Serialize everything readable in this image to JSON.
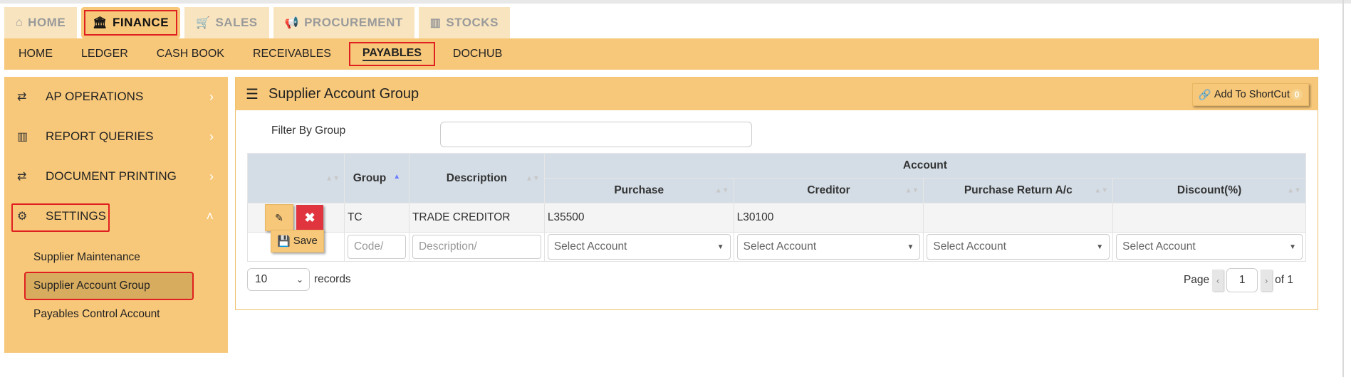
{
  "main_tabs": [
    {
      "label": "HOME",
      "icon": "home-icon",
      "active": false
    },
    {
      "label": "FINANCE",
      "icon": "bank-icon",
      "active": true
    },
    {
      "label": "SALES",
      "icon": "cart-icon",
      "active": false
    },
    {
      "label": "PROCUREMENT",
      "icon": "bullhorn-icon",
      "active": false
    },
    {
      "label": "STOCKS",
      "icon": "bar-chart-icon",
      "active": false
    }
  ],
  "sub_nav": {
    "items": [
      "HOME",
      "LEDGER",
      "CASH BOOK",
      "RECEIVABLES",
      "PAYABLES",
      "DOCHUB"
    ],
    "active": "PAYABLES"
  },
  "sidebar": {
    "items": [
      {
        "label": "AP OPERATIONS",
        "icon": "exchange-icon"
      },
      {
        "label": "REPORT QUERIES",
        "icon": "bar-chart-icon"
      },
      {
        "label": "DOCUMENT PRINTING",
        "icon": "exchange-icon"
      },
      {
        "label": "SETTINGS",
        "icon": "cogs-icon"
      }
    ],
    "sub_items": [
      "Supplier Maintenance",
      "Supplier Account Group",
      "Payables Control Account"
    ],
    "active_sub": "Supplier Account Group"
  },
  "panel": {
    "title": "Supplier Account Group",
    "shortcut_label": "Add To ShortCut",
    "shortcut_count": "0",
    "filter_label": "Filter By Group",
    "filter_value": ""
  },
  "grid": {
    "headers": {
      "group": "Group",
      "description": "Description",
      "account": "Account",
      "purchase": "Purchase",
      "creditor": "Creditor",
      "purchase_return": "Purchase Return A/c",
      "discount": "Discount(%)"
    },
    "rows": [
      {
        "group": "TC",
        "description": "TRADE CREDITOR",
        "purchase": "L35500",
        "creditor": "L30100",
        "purchase_return": "",
        "discount": ""
      }
    ],
    "new_row": {
      "code_placeholder": "Code/",
      "description_placeholder": "Description/",
      "select_placeholder": "Select Account",
      "save_label": "Save"
    }
  },
  "footer": {
    "records_value": "10",
    "records_label": "records",
    "page_label": "Page",
    "page_value": "1",
    "of_label": "of 1"
  }
}
